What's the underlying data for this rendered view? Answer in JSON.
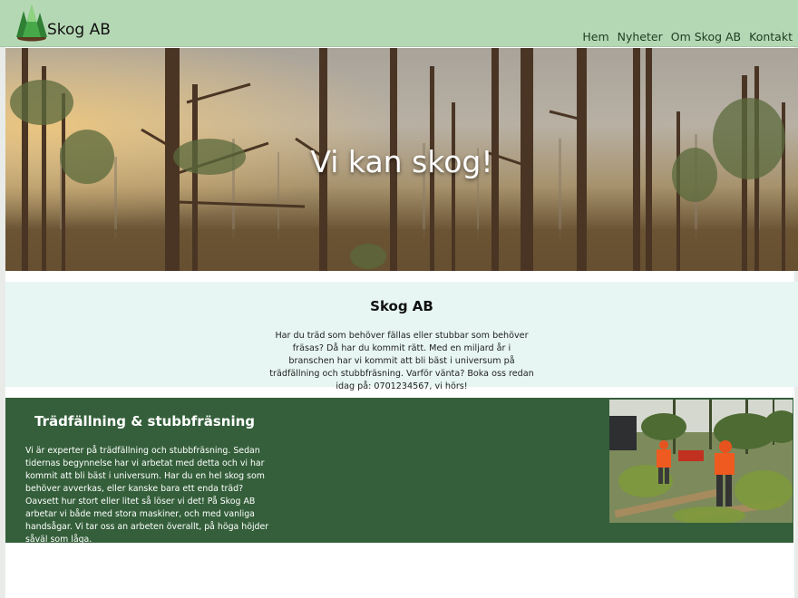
{
  "brand": {
    "name": "Skog AB",
    "logo_icon": "tree-logo-icon"
  },
  "nav": {
    "items": [
      "Hem",
      "Nyheter",
      "Om Skog AB",
      "Kontakt"
    ]
  },
  "hero": {
    "title": "Vi kan skog!"
  },
  "intro": {
    "title": "Skog AB",
    "text": "Har du träd som behöver fällas eller stubbar som behöver fräsas? Då har du kommit rätt. Med en miljard år i branschen har vi kommit att bli bäst i universum på trädfällning och stubbfräsning. Varför vänta? Boka oss redan idag på: 0701234567, vi hörs!"
  },
  "service": {
    "title": "Trädfällning & stubbfräsning",
    "text": "Vi är experter på trädfällning och stubbfräsning. Sedan tidernas begynnelse har vi arbetat med detta och vi har kommit att bli bäst i universum. Har du en hel skog som behöver avverkas, eller kanske bara ett enda träd? Oavsett hur stort eller litet så löser vi det! På Skog AB arbetar vi både med stora maskiner, och med vanliga handsågar. Vi tar oss an arbeten överallt, på höga höjder såväl som låga."
  },
  "colors": {
    "header_bg": "#b5d8b4",
    "intro_bg": "#e7f6f2",
    "service_bg": "#345f3a"
  }
}
